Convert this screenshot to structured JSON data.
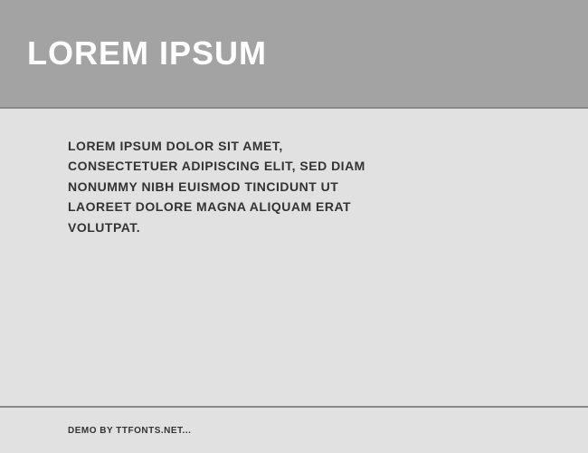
{
  "header": {
    "title": "Lorem Ipsum"
  },
  "content": {
    "body": "Lorem ipsum dolor sit amet, consectetuer adipiscing elit, sed diam nonummy nibh euismod tincidunt ut laoreet dolore magna aliquam erat volutpat."
  },
  "footer": {
    "credit": "Demo by ttfonts.net..."
  }
}
